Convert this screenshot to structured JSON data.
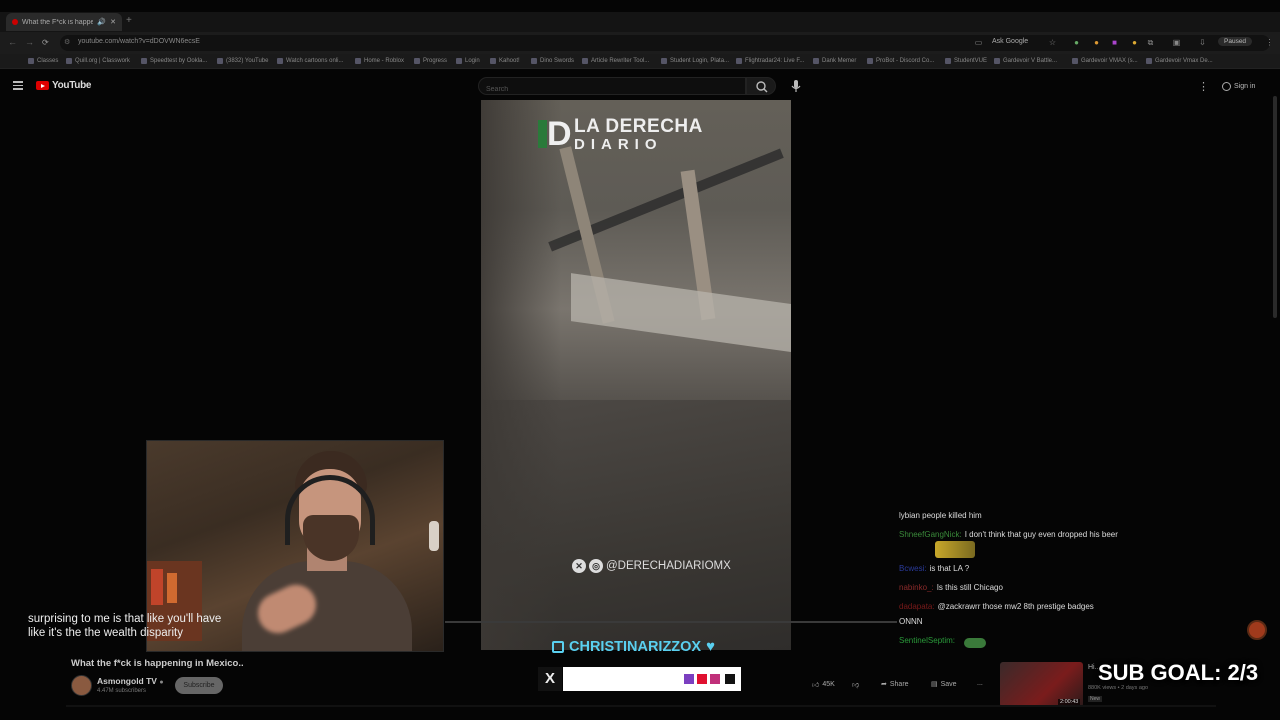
{
  "browser": {
    "tab_title": "What the F*ck is happening...",
    "new_tab": "+",
    "url": "youtube.com/watch?v=dDOVWN6ecsE",
    "ask_google": "Ask Google",
    "paused": "Paused",
    "bookmarks": [
      "Classes",
      "Quill.org | Classwork",
      "Speedtest by Ookla...",
      "(3832) YouTube",
      "Watch cartoons onli...",
      "Home - Roblox",
      "Progress",
      "Login",
      "Kahoot!",
      "Dino Swords",
      "Article Rewriter Tool...",
      "Student Login, Plata...",
      "Flightradar24: Live F...",
      "Dank Memer",
      "ProBot - Discord Co...",
      "StudentVUE",
      "Gardevoir V Battle...",
      "Gardevoir VMAX (s...",
      "Gardevoir Vmax De..."
    ]
  },
  "youtube": {
    "logo_text": "YouTube",
    "search_placeholder": "Search",
    "sign_in": "Sign in",
    "video_title": "What the f*ck is happening in Mexico..",
    "channel_name": "Asmongold TV",
    "channel_subs": "4.47M subscribers",
    "subscribe": "Subscribe",
    "likes": "45K",
    "share": "Share",
    "save": "Save",
    "more": "...",
    "rec_title": "Hi...",
    "rec_views": "880K views • 2 days ago",
    "rec_new": "New",
    "rec_duration": "2:00:43"
  },
  "video": {
    "logo_line1": "LA DERECHA",
    "logo_line2": "DIARIO",
    "handle": "@DERECHADIARIOMX"
  },
  "stream": {
    "caption": "surprising to me is that like you'll have like it's the the wealth disparity",
    "twitch_user": "CHRISTINARIZZOX",
    "sub_goal": "SUB GOAL: 2/3",
    "colors": {
      "purple": "#7b3fc0",
      "red": "#e01030",
      "magenta": "#c0307a",
      "black": "#111111",
      "twitch_cyan": "#5ad0f0"
    }
  },
  "chat": [
    {
      "user": "",
      "user_color": "#ddd",
      "text": "lybian people killed him"
    },
    {
      "user": "ShneefGangNick:",
      "user_color": "#3a8a3a",
      "text": "I don't think that guy even dropped his beer"
    },
    {
      "user": "Bcwesi:",
      "user_color": "#2a3a9a",
      "text": "is that LA ?"
    },
    {
      "user": "nabinko_:",
      "user_color": "#8a2a2a",
      "text": "Is this still Chicago"
    },
    {
      "user": "dadapata:",
      "user_color": "#7a1a1a",
      "text": "@zackrawrr those mw2 8th prestige badges"
    },
    {
      "user": "",
      "user_color": "#ddd",
      "text": "ONNN"
    },
    {
      "user": "SentinelSeptim:",
      "user_color": "#2a9a3a",
      "text": ""
    }
  ]
}
